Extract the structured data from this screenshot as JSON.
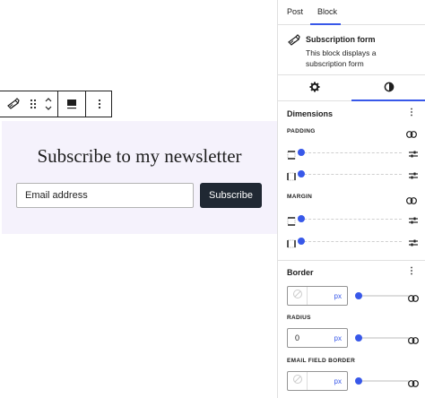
{
  "editor": {
    "block_title": "Subscribe to my newsletter",
    "email_placeholder": "Email address",
    "subscribe_label": "Subscribe",
    "block_background": "#f5f2fc",
    "button_color": "#202833"
  },
  "toolbar": {
    "icons": [
      "subscription-form-icon",
      "drag-handle-icon",
      "move-up-down-icon",
      "align-icon",
      "more-options-icon"
    ]
  },
  "sidebar": {
    "tabs": [
      {
        "label": "Post",
        "active": false
      },
      {
        "label": "Block",
        "active": true
      }
    ],
    "block_card": {
      "title": "Subscription form",
      "description": "This block displays a subscription form"
    },
    "sub_tabs": [
      {
        "icon": "gear-icon",
        "active": false
      },
      {
        "icon": "contrast-icon",
        "active": true
      }
    ],
    "dimensions": {
      "title": "Dimensions",
      "padding_label": "PADDING",
      "margin_label": "MARGIN",
      "padding_values": [
        0,
        0
      ],
      "margin_values": [
        0,
        0
      ]
    },
    "border": {
      "title": "Border",
      "width_value": "",
      "width_unit": "px",
      "radius_label": "RADIUS",
      "radius_value": "0",
      "radius_unit": "px",
      "email_field_border_label": "EMAIL FIELD BORDER",
      "email_field_border_value": "",
      "email_field_border_unit": "px"
    },
    "accent_color": "#3858e9"
  }
}
